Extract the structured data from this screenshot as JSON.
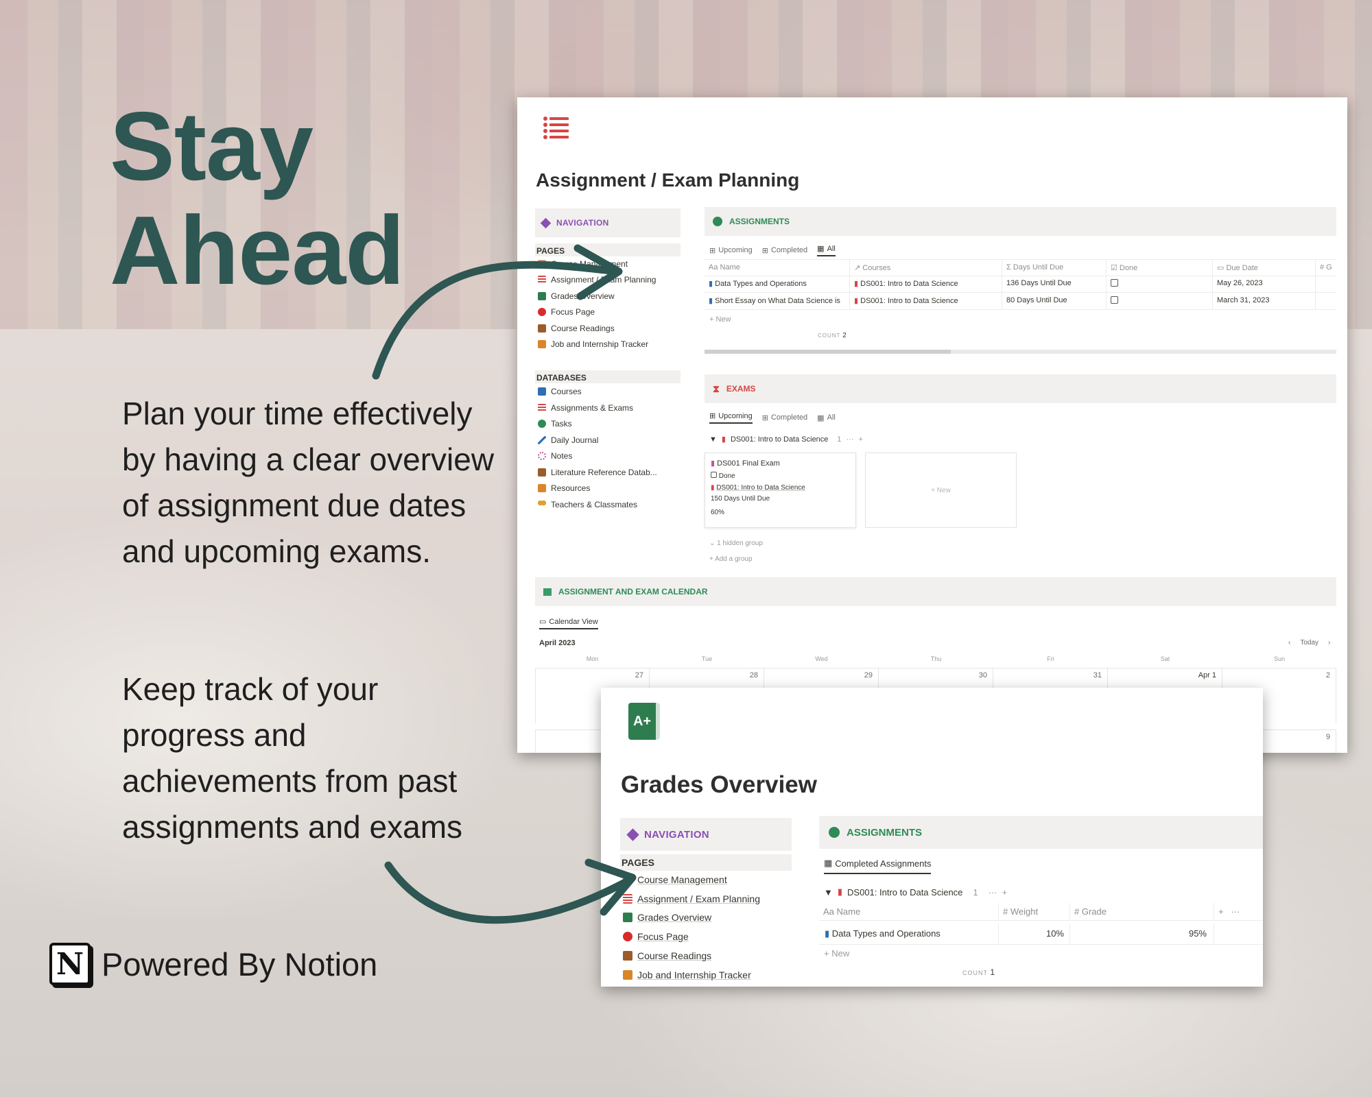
{
  "hero": {
    "line1": "Stay",
    "line2": "Ahead"
  },
  "paragraphs": {
    "p1": "Plan your time effectively by having a clear overview of assignment due dates and upcoming exams.",
    "p2": "Keep track of your progress and achievements from past assignments and exams"
  },
  "powered": {
    "logo": "N",
    "text": "Powered By Notion"
  },
  "colors": {
    "heading": "#2e5652",
    "arrow": "#2e5652",
    "nav_purple": "#8a4fb3",
    "assign_green": "#2e8b57",
    "exam_red": "#d64545",
    "accent_red": "#d9534f"
  },
  "win1": {
    "title": "Assignment / Exam Planning",
    "icon": "list-icon",
    "nav_label": "NAVIGATION",
    "pages_label": "PAGES",
    "pages": [
      "Course Management",
      "Assignment / Exam Planning",
      "Grades Overview",
      "Focus Page",
      "Course Readings",
      "Job and Internship Tracker"
    ],
    "databases_label": "DATABASES",
    "databases": [
      "Courses",
      "Assignments & Exams",
      "Tasks",
      "Daily Journal",
      "Notes",
      "Literature Reference Datab...",
      "Resources",
      "Teachers & Classmates"
    ],
    "assignments": {
      "label": "ASSIGNMENTS",
      "tabs": [
        "Upcoming",
        "Completed",
        "All"
      ],
      "headers": [
        "Aa Name",
        "↗ Courses",
        "Σ Days Until Due",
        "☑ Done",
        "▭ Due Date",
        "# G"
      ],
      "rows": [
        {
          "name": "Data Types and Operations",
          "course": "DS001: Intro to Data Science",
          "days": "136 Days Until Due",
          "date": "May 26, 2023"
        },
        {
          "name": "Short Essay on What Data Science is",
          "course": "DS001: Intro to Data Science",
          "days": "80 Days Until Due",
          "date": "March 31, 2023"
        }
      ],
      "new": "+ New",
      "count_label": "COUNT",
      "count": "2"
    },
    "exams": {
      "label": "EXAMS",
      "tabs": [
        "Upcoming",
        "Completed",
        "All"
      ],
      "group": "DS001: Intro to Data Science",
      "group_count": "1",
      "card": {
        "title": "DS001 Final Exam",
        "done": "Done",
        "course": "DS001: Intro to Data Science",
        "days": "150 Days Until Due",
        "pct": "60%"
      },
      "new": "+ New",
      "hidden": "1 hidden group",
      "add_group": "+ Add a group"
    },
    "calendar": {
      "label": "ASSIGNMENT AND EXAM CALENDAR",
      "view": "Calendar View",
      "month": "April 2023",
      "today": "Today",
      "days": [
        "Mon",
        "Tue",
        "Wed",
        "Thu",
        "Fri",
        "Sat",
        "Sun"
      ],
      "week1": [
        "27",
        "28",
        "29",
        "30",
        "31",
        "Apr 1",
        "2"
      ],
      "week2_last": "9"
    }
  },
  "win2": {
    "title": "Grades Overview",
    "icon": "grade-book-icon",
    "icon_text": "A+",
    "nav_label": "NAVIGATION",
    "pages_label": "PAGES",
    "pages": [
      "Course Management",
      "Assignment / Exam Planning",
      "Grades Overview",
      "Focus Page",
      "Course Readings",
      "Job and Internship Tracker"
    ],
    "assignments_label": "ASSIGNMENTS",
    "view": "Completed Assignments",
    "group": "DS001: Intro to Data Science",
    "group_count": "1",
    "headers": [
      "Aa Name",
      "# Weight",
      "# Grade"
    ],
    "row": {
      "name": "Data Types and Operations",
      "weight": "10%",
      "grade": "95%"
    },
    "new": "+ New",
    "count_label": "COUNT",
    "count": "1"
  }
}
